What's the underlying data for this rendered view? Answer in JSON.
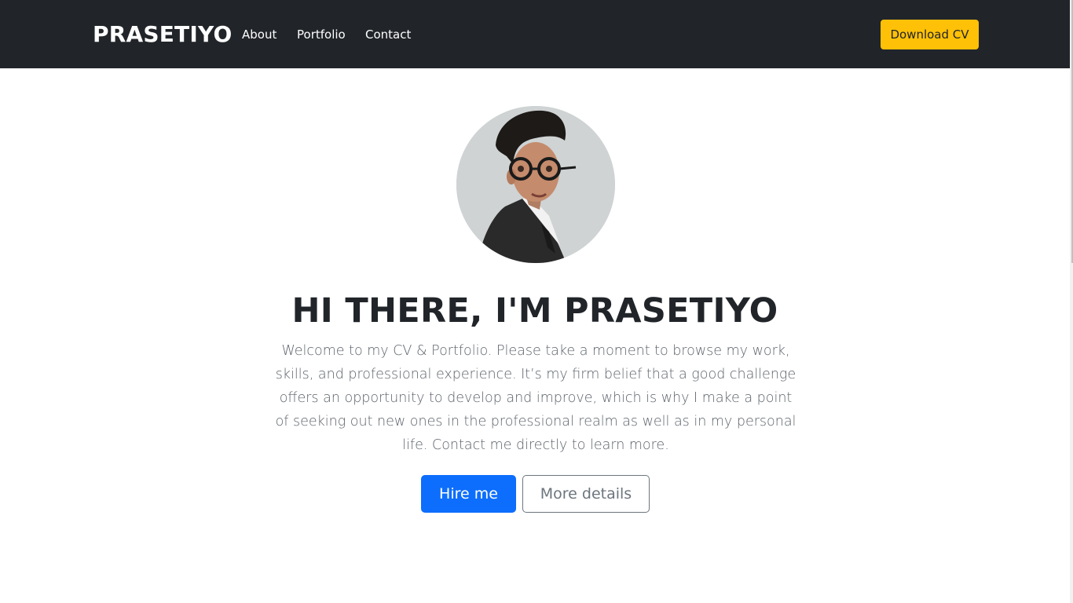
{
  "navbar": {
    "brand": "PRASETIYO",
    "links": [
      "About",
      "Portfolio",
      "Contact"
    ],
    "download_cv_label": "Download CV"
  },
  "hero": {
    "profile_photo_alt": "Profile photo of Prasetiyo",
    "title": "HI THERE, I'M PRASETIYO",
    "text": "Welcome to my CV & Portfolio. Please take a moment to browse my work, skills, and professional experience. It’s my firm belief that a good challenge offers an opportunity to develop and improve, which is why I make a point of seeking out new ones in the professional realm as well as in my personal life. Contact me directly to learn more.",
    "hire_label": "Hire me",
    "details_label": "More details"
  },
  "colors": {
    "navbar_bg": "#212529",
    "accent_yellow": "#ffc107",
    "primary_blue": "#0d6efd",
    "secondary_gray": "#6c757d"
  }
}
